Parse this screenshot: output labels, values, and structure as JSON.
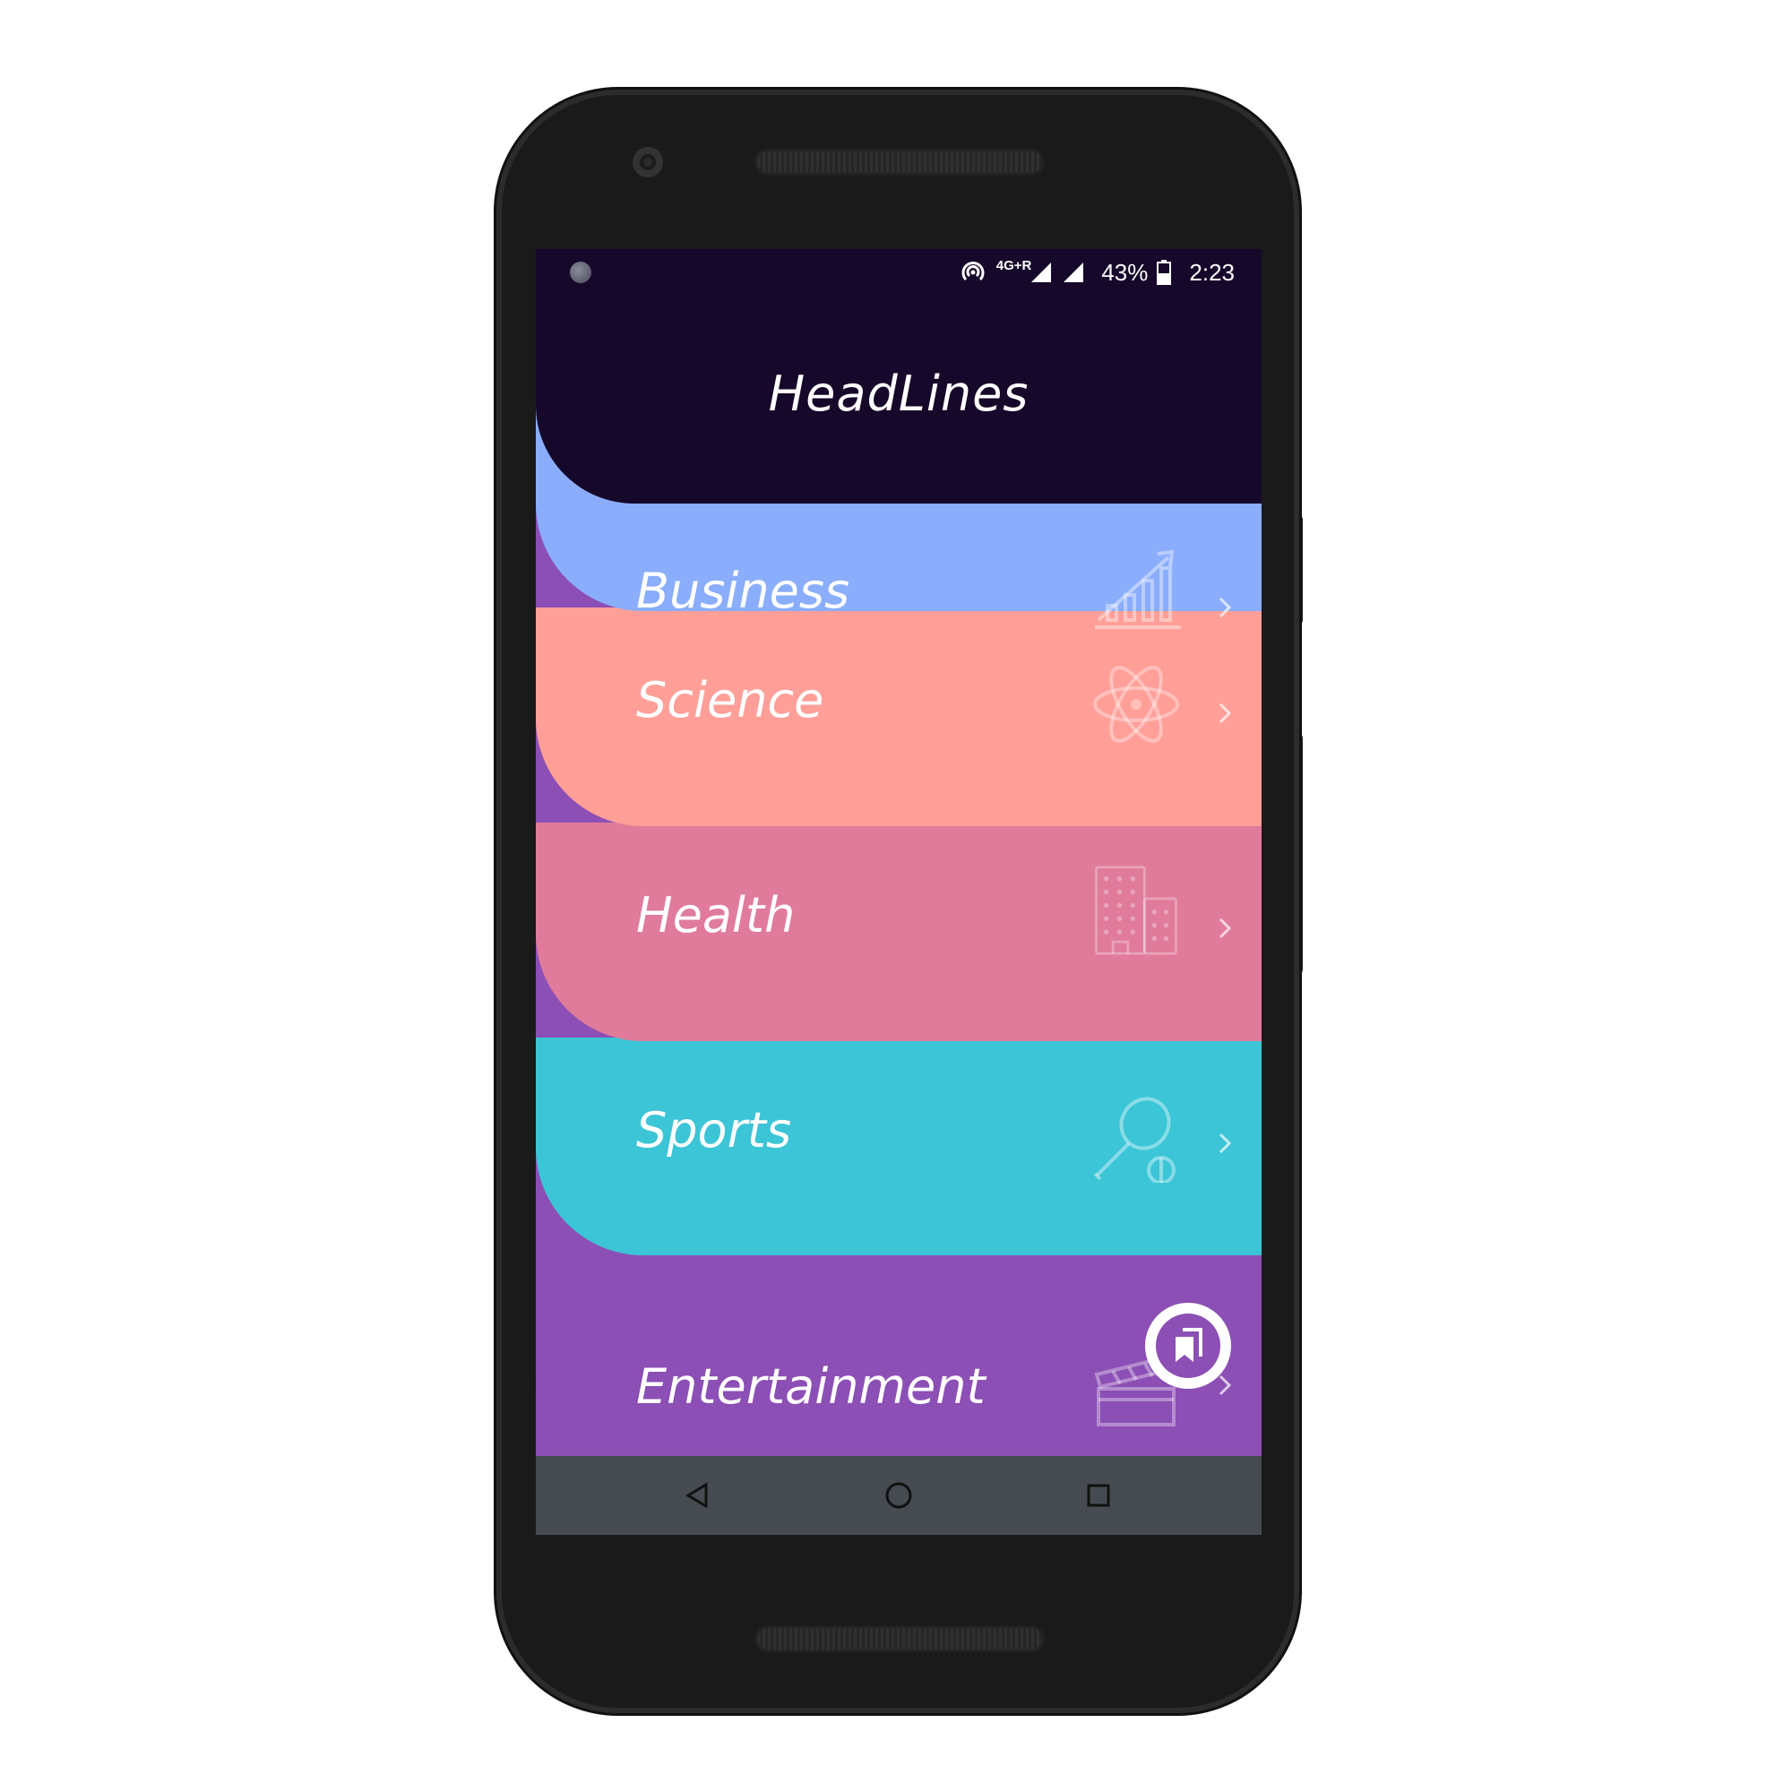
{
  "status_bar": {
    "network": "4G+R",
    "battery": "43%",
    "time": "2:23",
    "icons": [
      "notification-dot-icon",
      "hotspot-icon",
      "signal-icon",
      "signal-icon",
      "battery-icon"
    ]
  },
  "app": {
    "title": "HeadLines"
  },
  "categories": [
    {
      "label": "Business",
      "icon": "bar-chart-icon",
      "color": "#8aadfc"
    },
    {
      "label": "Science",
      "icon": "atom-icon",
      "color": "#ff9f98"
    },
    {
      "label": "Health",
      "icon": "building-icon",
      "color": "#e07b9b"
    },
    {
      "label": "Sports",
      "icon": "tennis-racket-icon",
      "color": "#3bc5d6"
    },
    {
      "label": "Entertainment",
      "icon": "clapperboard-icon",
      "color": "#8c4fb5"
    }
  ],
  "fab": {
    "icon": "bookmarks-icon"
  },
  "nav_bar": {
    "icons": [
      "back-icon",
      "home-icon",
      "recents-icon"
    ]
  },
  "colors": {
    "header": "#16082a",
    "nav_bar": "#454b51",
    "text": "#ffffff"
  }
}
